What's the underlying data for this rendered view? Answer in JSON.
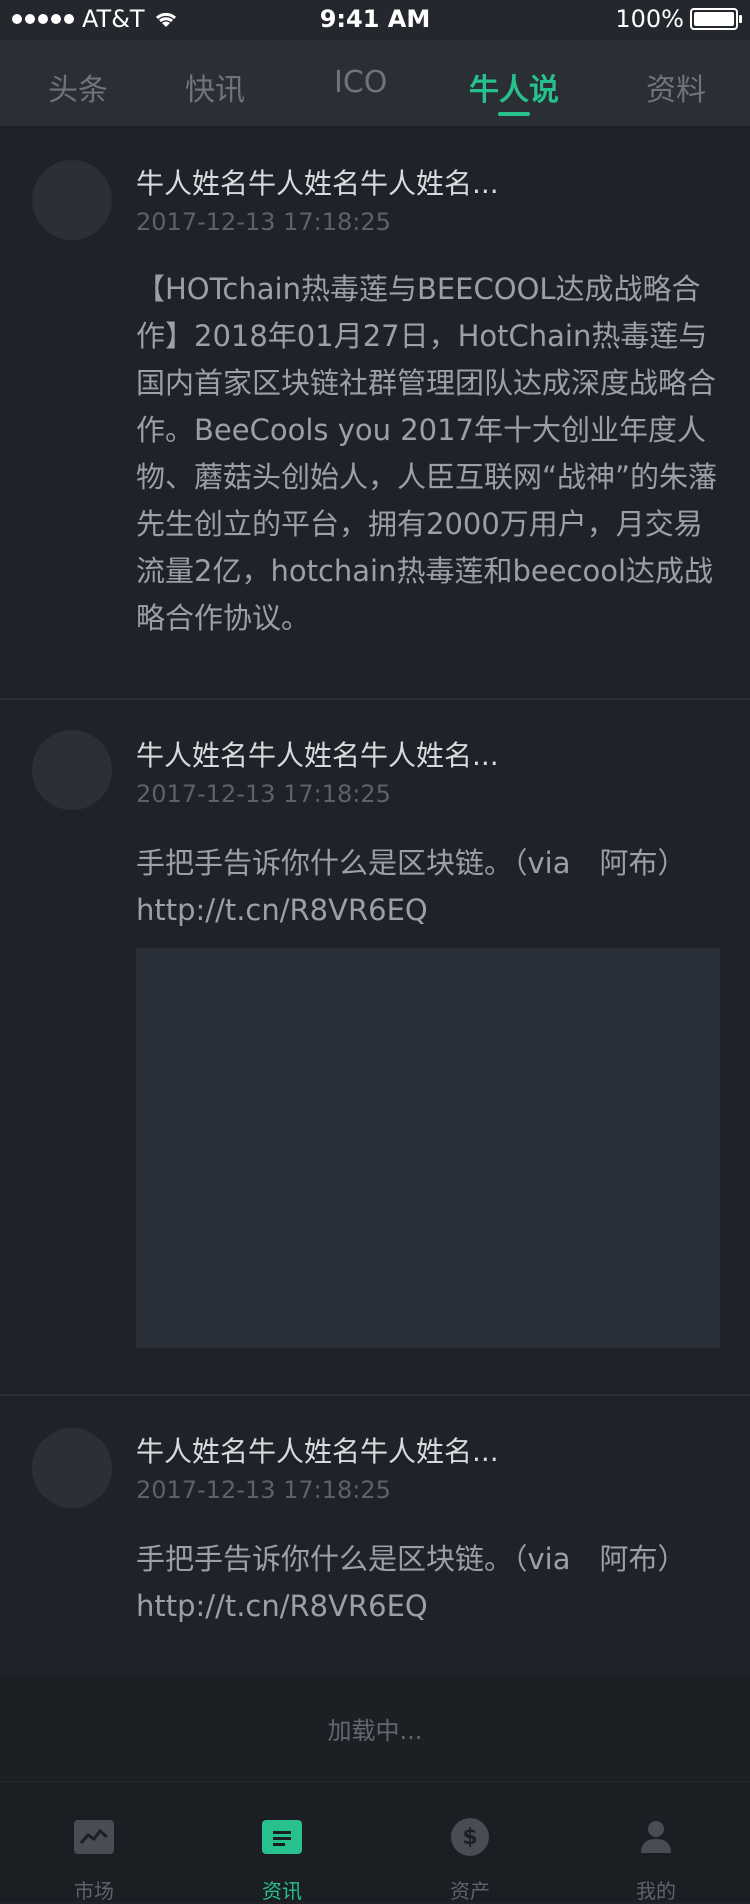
{
  "status_bar": {
    "carrier": "AT&T",
    "time": "9:41 AM",
    "battery": "100%",
    "battery_level": 1.0
  },
  "tabs": [
    {
      "label": "头条",
      "active": false
    },
    {
      "label": "快讯",
      "active": false
    },
    {
      "label": "ICO",
      "active": false
    },
    {
      "label": "牛人说",
      "active": true
    },
    {
      "label": "资料",
      "active": false
    }
  ],
  "posts": [
    {
      "name": "牛人姓名牛人姓名牛人姓名...",
      "time": "2017-12-13 17:18:25",
      "content": "【HOTchain热毒莲与BEECOOL达成战略合作】2018年01月27日，HotChain热毒莲与国内首家区块链社群管理团队达成深度战略合作。BeeCools you 2017年十大创业年度人物、蘑菇头创始人，人臣互联网“战神”的朱藩先生创立的平台，拥有2000万用户，月交易流量2亿，hotchain热毒莲和beecool达成战略合作协议。"
    },
    {
      "name": "牛人姓名牛人姓名牛人姓名...",
      "time": "2017-12-13 17:18:25",
      "content": "手把手告诉你什么是区块链。（via　阿布）http://t.cn/R8VR6EQ",
      "has_image": true
    },
    {
      "name": "牛人姓名牛人姓名牛人姓名...",
      "time": "2017-12-13 17:18:25",
      "content": "手把手告诉你什么是区块链。（via　阿布）http://t.cn/R8VR6EQ"
    }
  ],
  "loading_text": "加载中...",
  "tabbar": [
    {
      "label": "市场",
      "icon": "market-chart-icon",
      "active": false
    },
    {
      "label": "资讯",
      "icon": "news-icon",
      "active": true
    },
    {
      "label": "资产",
      "icon": "dollar-icon",
      "glyph": "$",
      "active": false
    },
    {
      "label": "我的",
      "icon": "person-icon",
      "active": false
    }
  ],
  "colors": {
    "accent": "#28c08c",
    "background": "#1f2228"
  }
}
